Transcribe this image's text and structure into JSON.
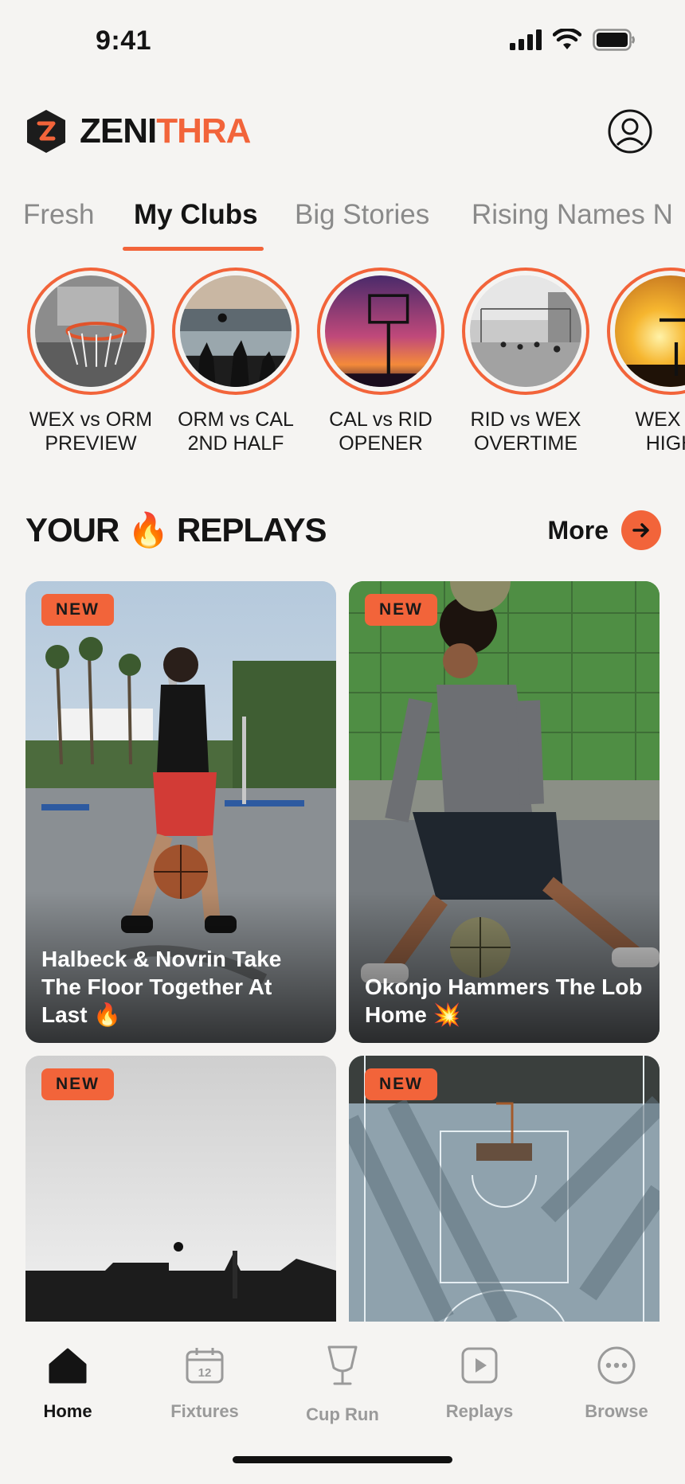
{
  "status_bar": {
    "time": "9:41"
  },
  "brand": {
    "name_part1": "ZENI",
    "name_part2": "THRA",
    "logo_letter": "Z"
  },
  "colors": {
    "accent": "#f2643a",
    "text": "#141414",
    "muted": "#9a9a9a",
    "background": "#f5f4f2"
  },
  "tabs": [
    {
      "label": "Fresh"
    },
    {
      "label": "My Clubs"
    },
    {
      "label": "Big Stories"
    },
    {
      "label": "Rising Names N"
    }
  ],
  "active_tab": "My Clubs",
  "stories": [
    {
      "label": "WEX vs ORM\nPREVIEW"
    },
    {
      "label": "ORM vs CAL\n2ND HALF"
    },
    {
      "label": "CAL vs RID\nOPENER"
    },
    {
      "label": "RID vs WEX\nOVERTIME"
    },
    {
      "label": "WEX vs\nHIGH"
    }
  ],
  "section": {
    "title": "YOUR 🔥 REPLAYS",
    "more_label": "More"
  },
  "cards": [
    {
      "badge": "NEW",
      "title": "Halbeck & Novrin Take The Floor Together At Last 🔥"
    },
    {
      "badge": "NEW",
      "title": "Okonjo Hammers The Lob Home 💥"
    },
    {
      "badge": "NEW",
      "title": ""
    },
    {
      "badge": "NEW",
      "title": ""
    }
  ],
  "bottom_nav": [
    {
      "label": "Home",
      "icon": "home-icon"
    },
    {
      "label": "Fixtures",
      "icon": "calendar-icon"
    },
    {
      "label": "Cup Run",
      "icon": "trophy-icon"
    },
    {
      "label": "Replays",
      "icon": "play-icon"
    },
    {
      "label": "Browse",
      "icon": "more-icon"
    }
  ]
}
